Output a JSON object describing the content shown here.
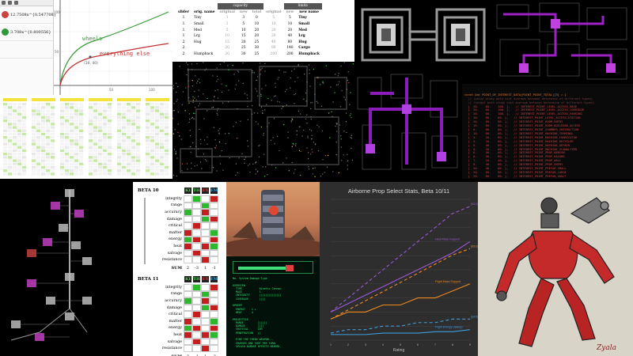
{
  "graph": {
    "expressions": [
      {
        "text": "12.7508x^{0.547708}",
        "color": "#c74440"
      },
      {
        "text": "3.708x^{0.800556}",
        "color": "#2d70b3"
      }
    ],
    "labels": {
      "wheels": "wheels",
      "else": "everything else",
      "point": "(30, 40)"
    },
    "ticks": {
      "x": [
        "50",
        "100"
      ],
      "y": [
        "100",
        "50"
      ]
    },
    "colors": {
      "wheels": "#3a9a3a",
      "else": "#c03030"
    }
  },
  "table": {
    "group_headers": {
      "capacity": "capacity",
      "limits": "limits"
    },
    "headers": [
      "slider",
      "orig. name",
      "original",
      "new",
      "total",
      "original",
      "new",
      "new name"
    ],
    "rows": [
      [
        "1",
        "Tiny",
        "1",
        "3",
        "0",
        "5",
        "5",
        "Tiny"
      ],
      [
        "1",
        "Small",
        "1",
        "5",
        "10",
        "10",
        "10",
        "Small"
      ],
      [
        "1",
        "Med",
        "5",
        "10",
        "20",
        "20",
        "20",
        "Med"
      ],
      [
        "1",
        "Lrg",
        "10",
        "15",
        "20",
        "20",
        "40",
        "Lrg"
      ],
      [
        "2",
        "Hug",
        "15",
        "20",
        "25",
        "40",
        "80",
        "Hug"
      ],
      [
        "2",
        "",
        "20",
        "25",
        "30",
        "80",
        "140",
        "Cargo"
      ],
      [
        "2",
        "Humpback",
        "30",
        "30",
        "25",
        "200",
        "200",
        "Humpback"
      ]
    ],
    "gray_notes": [
      "new",
      "new"
    ]
  },
  "code": {
    "lines": [
      "const Dat POINT_OF_INTEREST_DATA[POINT_POINT_TOTAL][3] = {",
      "  // (value study path cost average between determine of different types)",
      "  // (target path study cost average between determine of different types)",
      "  {  20.    60.    100. },   // INTEREST_POINT_LEVEL_ACCESS_BASE",
      "  {  20.    60.    100. },   // INTEREST_POINT_LEVEL_ACCESS_CORRIDOR",
      "  {  20.    60.    100. },   // INTEREST_POINT_LEVEL_ACCESS_PARKING",
      "  {  10.    60.    60. },   // INTEREST_POINT_LEVEL_ACCESS_STATION",
      "  {  20.    60.    60. },   // INTEREST_POINT_ROOM_ENTRY",
      "  {  16.    60.    60. },   // INTEREST_POINT_ROOM_BUILDING_ACCESS",
      "  {  0.     60.    60. },   // INTEREST_POINT_CHAMBER_INTERACTION",
      "  {  10.    60.    60. },   // INTEREST_POINT_MACHINE_TERMINAL",
      "  {  5.     20.    60. },   // INTEREST_POINT_MACHINE_FABRICATOR",
      "  {  5.     20.    60. },   // INTEREST_POINT_MACHINE_RECYCLER",
      "  {  6.     40.    60. },   // INTEREST_POINT_MACHINE_REPAIR",
      "  {  0.     20.    60. },   // INTEREST_POINT_MACHINE_SCANALYZER",
      "  {  6.     40.    60. },   // INTEREST_POINT_PROP_BENIGN",
      "  {  6.     50.    60. },   // INTEREST_POINT_PROP_HAZARD",
      "  {  7.     10.    40. },   // INTEREST_POINT_PROP_WALL",
      "  {  8.     40.    60. },   // INTEREST_POINT_PROP_ENTRY",
      "  {  20.    40.    60. },   // INTEREST_POINT_PREFAB_SMALL",
      "  {  20.    60.    60. },   // INTEREST_POINT_PREFAB_LARGE",
      "  {  20.    60.    60. },   // INTEREST_POINT_PREFAB_VAULT",
      "};"
    ]
  },
  "beta": {
    "sections": [
      {
        "title": "BETA 10",
        "cols": [
          "KI",
          "TH",
          "EX",
          "EM"
        ],
        "col_colors": [
          "#22ee22",
          "#22ee22",
          "#ee3333",
          "#22aaff"
        ],
        "rows": [
          {
            "label": "integrity",
            "cells": [
              "#fff",
              "#2db82d",
              "#fff",
              "#c41e1e"
            ]
          },
          {
            "label": "range",
            "cells": [
              "#fff",
              "#fff",
              "#2db82d",
              "#fff"
            ]
          },
          {
            "label": "accuracy",
            "cells": [
              "#2db82d",
              "#fff",
              "#c41e1e",
              "#fff"
            ]
          },
          {
            "label": "damage",
            "cells": [
              "#fff",
              "#fff",
              "#2db82d",
              "#c41e1e"
            ]
          },
          {
            "label": "critical",
            "cells": [
              "#fff",
              "#c41e1e",
              "#fff",
              "#fff"
            ]
          },
          {
            "label": "matter",
            "cells": [
              "#c41e1e",
              "#fff",
              "#fff",
              "#2db82d"
            ]
          },
          {
            "label": "energy",
            "cells": [
              "#2db82d",
              "#c41e1e",
              "#fff",
              "#c41e1e"
            ]
          },
          {
            "label": "heat",
            "cells": [
              "#c41e1e",
              "#fff",
              "#c41e1e",
              "#2db82d"
            ]
          },
          {
            "label": "salvage",
            "cells": [
              "#fff",
              "#c41e1e",
              "#fff",
              "#fff"
            ]
          },
          {
            "label": "resistance",
            "cells": [
              "#fff",
              "#fff",
              "#c41e1e",
              "#fff"
            ]
          }
        ],
        "sum": [
          "2",
          "-3",
          "1",
          "-1"
        ]
      },
      {
        "title": "BETA 11",
        "cols": [
          "KI",
          "TH",
          "EX",
          "EM"
        ],
        "col_colors": [
          "#22ee22",
          "#22ee22",
          "#ee3333",
          "#22aaff"
        ],
        "rows": [
          {
            "label": "integrity",
            "cells": [
              "#fff",
              "#2db82d",
              "#fff",
              "#c41e1e"
            ]
          },
          {
            "label": "range",
            "cells": [
              "#fff",
              "#fff",
              "#2db82d",
              "#fff"
            ]
          },
          {
            "label": "accuracy",
            "cells": [
              "#2db82d",
              "#fff",
              "#c41e1e",
              "#fff"
            ]
          },
          {
            "label": "damage",
            "cells": [
              "#fff",
              "#fff",
              "#2db82d",
              "#c41e1e"
            ]
          },
          {
            "label": "critical",
            "cells": [
              "#fff",
              "#c41e1e",
              "#fff",
              "#fff"
            ]
          },
          {
            "label": "matter",
            "cells": [
              "#c41e1e",
              "#fff",
              "#fff",
              "#2db82d"
            ]
          },
          {
            "label": "energy",
            "cells": [
              "#2db82d",
              "#c41e1e",
              "#fff",
              "#c41e1e"
            ]
          },
          {
            "label": "heat",
            "cells": [
              "#c41e1e",
              "#fff",
              "#c41e1e",
              "#2db82d"
            ]
          },
          {
            "label": "salvage",
            "cells": [
              "#fff",
              "#c41e1e",
              "#fff",
              "#fff"
            ]
          },
          {
            "label": "resistance",
            "cells": [
              "#fff",
              "#fff",
              "#c41e1e",
              "#fff"
            ]
          }
        ],
        "sum": [
          "3",
          "-1",
          "1",
          "-2"
        ]
      }
    ],
    "sum_label": "SUM"
  },
  "terminal": {
    "lines": [
      "No. System Damage Type",
      "",
      "OVERVIEW",
      "  TYPE           Kinetic Cannon",
      "  MASS           1",
      "  INTEGRITY      ||||||||||||||",
      "  COVERAGE       ||||",
      "",
      "UPKEEP",
      "  ENERGY    1 +",
      "  HEAT      4",
      "",
      "PROJECTILE",
      "  RANGE         ||||||",
      "  DAMAGE        ||||",
      "  CRITICAL      10%",
      "  PENETRATION   ||",
      "",
      "  FIRE THE THING WEAPON...",
      "  CHARGES ONE SHOT PER TURN.",
      "  SPLASH DAMAGE AFFECTS NEARBY."
    ]
  },
  "chart_data": {
    "type": "line",
    "title": "Airborne Prop Select Stats, Beta 10/11",
    "xlabel": "Rating",
    "ylabel": "",
    "x": [
      1,
      2,
      3,
      4,
      5,
      6,
      7,
      8,
      9
    ],
    "ylim": [
      0,
      20
    ],
    "grid": true,
    "series": [
      {
        "name": "(B10)",
        "color": "#9b59d6",
        "dash": true,
        "values": [
          4,
          6,
          8,
          10,
          12,
          14,
          16,
          18,
          19
        ]
      },
      {
        "name": "Heat Mass Support",
        "color": "#9b59d6",
        "dash": false,
        "values": [
          4,
          5.2,
          6.4,
          7.6,
          8.8,
          10,
          11.2,
          12.4,
          14
        ]
      },
      {
        "name": "(B10)",
        "color": "#f08a1c",
        "dash": true,
        "values": [
          3,
          4.3,
          5.6,
          6.9,
          8.2,
          9.5,
          10.8,
          12.1,
          13
        ]
      },
      {
        "name": "Flight Mass Support",
        "color": "#f08a1c",
        "dash": false,
        "values": [
          3,
          4,
          4,
          5,
          5,
          6,
          6,
          7,
          8
        ]
      },
      {
        "name": "(B10)",
        "color": "#3f9fdc",
        "dash": true,
        "values": [
          1,
          1.5,
          1.5,
          2,
          2,
          2.5,
          2.5,
          3,
          3
        ]
      },
      {
        "name": "Flight Energy Upkeep",
        "color": "#3f9fdc",
        "dash": false,
        "values": [
          0.8,
          0.8,
          0.8,
          1,
          1,
          1,
          1.2,
          1.2,
          1.5
        ]
      }
    ]
  },
  "robot": {
    "signature": "Zyala"
  }
}
